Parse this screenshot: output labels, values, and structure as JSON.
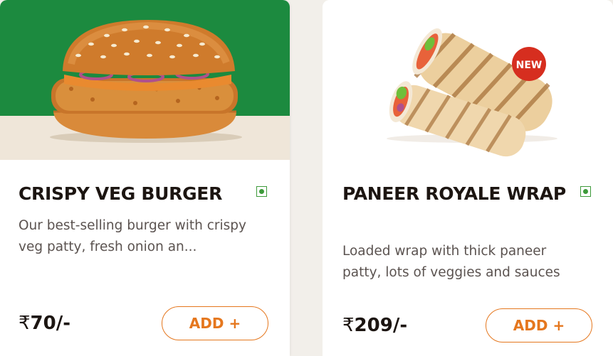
{
  "colors": {
    "veg_green": "#3d9a3a",
    "accent_orange": "#e5771e",
    "banner_green": "#1c8a3f"
  },
  "products": [
    {
      "title": "CRISPY VEG BURGER",
      "description": "Our best-selling burger with crispy veg patty, fresh onion an...",
      "currency": "₹",
      "price": "70/-",
      "add_label": "ADD +",
      "image_icon": "burger-image"
    },
    {
      "title": "PANEER ROYALE WRAP",
      "description": "Loaded wrap with thick paneer patty, lots of veggies and sauces",
      "currency": "₹",
      "price": "209/-",
      "add_label": "ADD +",
      "badge": "NEW",
      "image_icon": "wrap-image"
    }
  ]
}
